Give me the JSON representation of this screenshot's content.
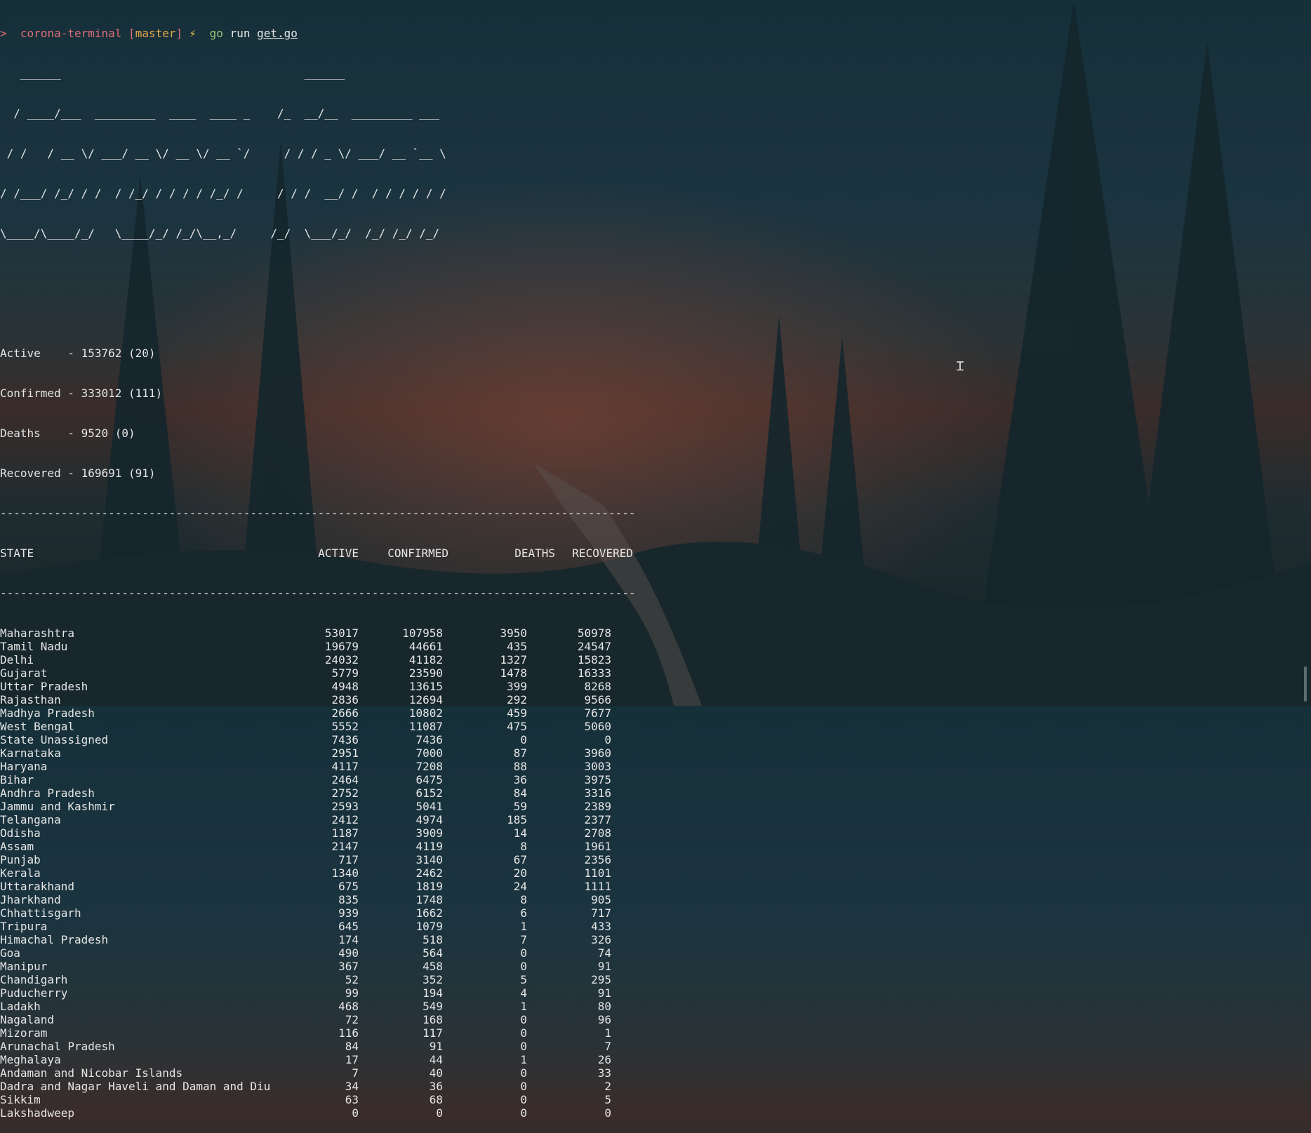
{
  "prompt": {
    "arrow": ">",
    "directory": "corona-terminal",
    "branch_open": "[",
    "branch": "master",
    "branch_close": "]",
    "bolt": "⚡",
    "command": "go",
    "subcommand": "run",
    "argument": "get.go"
  },
  "banner": [
    "   ______                                    ______",
    "  / ____/___  _________  ____  ____ _    /_  __/__  _________ ___",
    " / /   / __ \\/ ___/ __ \\/ __ \\/ __ `/     / / / _ \\/ ___/ __ `__ \\",
    "/ /___/ /_/ / /  / /_/ / / / / /_/ /     / / /  __/ /  / / / / / /",
    "\\____/\\____/_/   \\____/_/ /_/\\__,_/     /_/  \\___/_/  /_/ /_/ /_/"
  ],
  "summary": [
    "Active    - 153762 (20)",
    "Confirmed - 333012 (111)",
    "Deaths    - 9520 (0)",
    "Recovered - 169691 (91)"
  ],
  "separator": "----------------------------------------------------------------------------------------------",
  "table": {
    "headers": {
      "state": "STATE",
      "active": "ACTIVE",
      "confirmed": "CONFIRMED",
      "deaths": "DEATHS",
      "recovered": "RECOVERED"
    },
    "rows": [
      [
        "Maharashtra",
        "53017",
        "107958",
        "3950",
        "50978"
      ],
      [
        "Tamil Nadu",
        "19679",
        "44661",
        "435",
        "24547"
      ],
      [
        "Delhi",
        "24032",
        "41182",
        "1327",
        "15823"
      ],
      [
        "Gujarat",
        "5779",
        "23590",
        "1478",
        "16333"
      ],
      [
        "Uttar Pradesh",
        "4948",
        "13615",
        "399",
        "8268"
      ],
      [
        "Rajasthan",
        "2836",
        "12694",
        "292",
        "9566"
      ],
      [
        "Madhya Pradesh",
        "2666",
        "10802",
        "459",
        "7677"
      ],
      [
        "West Bengal",
        "5552",
        "11087",
        "475",
        "5060"
      ],
      [
        "State Unassigned",
        "7436",
        "7436",
        "0",
        "0"
      ],
      [
        "Karnataka",
        "2951",
        "7000",
        "87",
        "3960"
      ],
      [
        "Haryana",
        "4117",
        "7208",
        "88",
        "3003"
      ],
      [
        "Bihar",
        "2464",
        "6475",
        "36",
        "3975"
      ],
      [
        "Andhra Pradesh",
        "2752",
        "6152",
        "84",
        "3316"
      ],
      [
        "Jammu and Kashmir",
        "2593",
        "5041",
        "59",
        "2389"
      ],
      [
        "Telangana",
        "2412",
        "4974",
        "185",
        "2377"
      ],
      [
        "Odisha",
        "1187",
        "3909",
        "14",
        "2708"
      ],
      [
        "Assam",
        "2147",
        "4119",
        "8",
        "1961"
      ],
      [
        "Punjab",
        "717",
        "3140",
        "67",
        "2356"
      ],
      [
        "Kerala",
        "1340",
        "2462",
        "20",
        "1101"
      ],
      [
        "Uttarakhand",
        "675",
        "1819",
        "24",
        "1111"
      ],
      [
        "Jharkhand",
        "835",
        "1748",
        "8",
        "905"
      ],
      [
        "Chhattisgarh",
        "939",
        "1662",
        "6",
        "717"
      ],
      [
        "Tripura",
        "645",
        "1079",
        "1",
        "433"
      ],
      [
        "Himachal Pradesh",
        "174",
        "518",
        "7",
        "326"
      ],
      [
        "Goa",
        "490",
        "564",
        "0",
        "74"
      ],
      [
        "Manipur",
        "367",
        "458",
        "0",
        "91"
      ],
      [
        "Chandigarh",
        "52",
        "352",
        "5",
        "295"
      ],
      [
        "Puducherry",
        "99",
        "194",
        "4",
        "91"
      ],
      [
        "Ladakh",
        "468",
        "549",
        "1",
        "80"
      ],
      [
        "Nagaland",
        "72",
        "168",
        "0",
        "96"
      ],
      [
        "Mizoram",
        "116",
        "117",
        "0",
        "1"
      ],
      [
        "Arunachal Pradesh",
        "84",
        "91",
        "0",
        "7"
      ],
      [
        "Meghalaya",
        "17",
        "44",
        "1",
        "26"
      ],
      [
        "Andaman and Nicobar Islands",
        "7",
        "40",
        "0",
        "33"
      ],
      [
        "Dadra and Nagar Haveli and Daman and Diu",
        "34",
        "36",
        "0",
        "2"
      ],
      [
        "Sikkim",
        "63",
        "68",
        "0",
        "5"
      ],
      [
        "Lakshadweep",
        "0",
        "0",
        "0",
        "0"
      ]
    ]
  }
}
